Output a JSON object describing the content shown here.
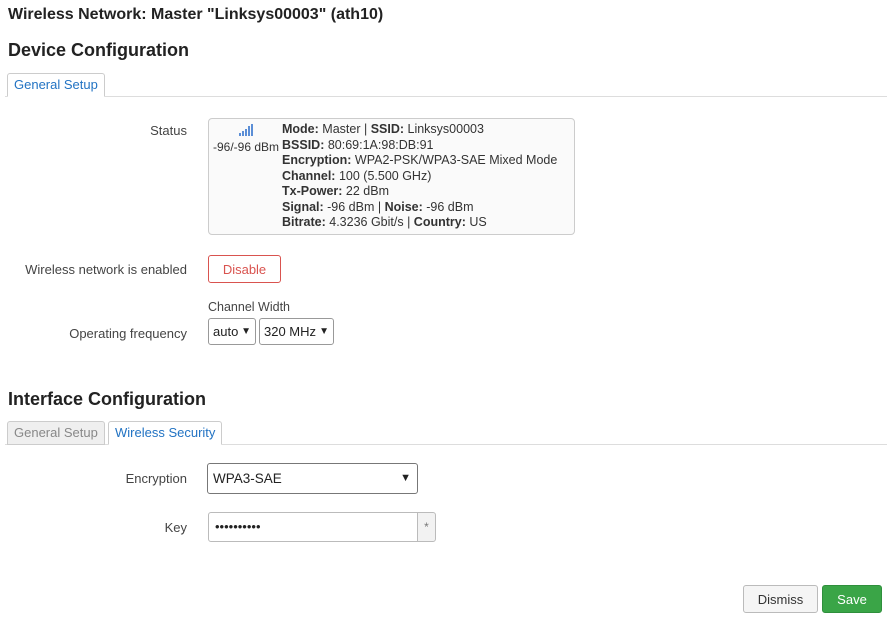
{
  "page": {
    "title": "Wireless Network: Master \"Linksys00003\" (ath10)"
  },
  "device_config": {
    "title": "Device Configuration",
    "tabs": [
      {
        "label": "General Setup",
        "active": true
      }
    ],
    "status": {
      "label": "Status",
      "signal_icon": "signal-bars-icon",
      "signal_text": "-96/-96 dBm",
      "mode_label": "Mode:",
      "mode_value": " Master | ",
      "ssid_label": "SSID:",
      "ssid_value": " Linksys00003",
      "bssid_label": "BSSID:",
      "bssid_value": " 80:69:1A:98:DB:91",
      "encryption_label": "Encryption:",
      "encryption_value": " WPA2-PSK/WPA3-SAE Mixed Mode",
      "channel_label": "Channel:",
      "channel_value": " 100 (5.500 GHz)",
      "txpower_label": "Tx-Power:",
      "txpower_value": " 22 dBm",
      "signal_label": "Signal:",
      "signal_value": " -96 dBm | ",
      "noise_label": "Noise:",
      "noise_value": " -96 dBm",
      "bitrate_label": "Bitrate:",
      "bitrate_value": " 4.3236 Gbit/s | ",
      "country_label": "Country:",
      "country_value": " US"
    },
    "enabled": {
      "label": "Wireless network is enabled",
      "button": "Disable"
    },
    "frequency": {
      "label": "Operating frequency",
      "channel_width_label": "Channel Width",
      "band_select": "auto",
      "width_select": "320 MHz"
    }
  },
  "interface_config": {
    "title": "Interface Configuration",
    "tabs": [
      {
        "label": "General Setup",
        "active": false
      },
      {
        "label": "Wireless Security",
        "active": true
      }
    ],
    "encryption": {
      "label": "Encryption",
      "value": "WPA3-SAE"
    },
    "key": {
      "label": "Key",
      "value": "••••••••••",
      "reveal_icon": "asterisk-icon",
      "reveal_glyph": "*"
    }
  },
  "footer": {
    "dismiss": "Dismiss",
    "save": "Save"
  },
  "colors": {
    "accent": "#2273c3",
    "danger": "#d9534f",
    "success": "#3aa547"
  }
}
